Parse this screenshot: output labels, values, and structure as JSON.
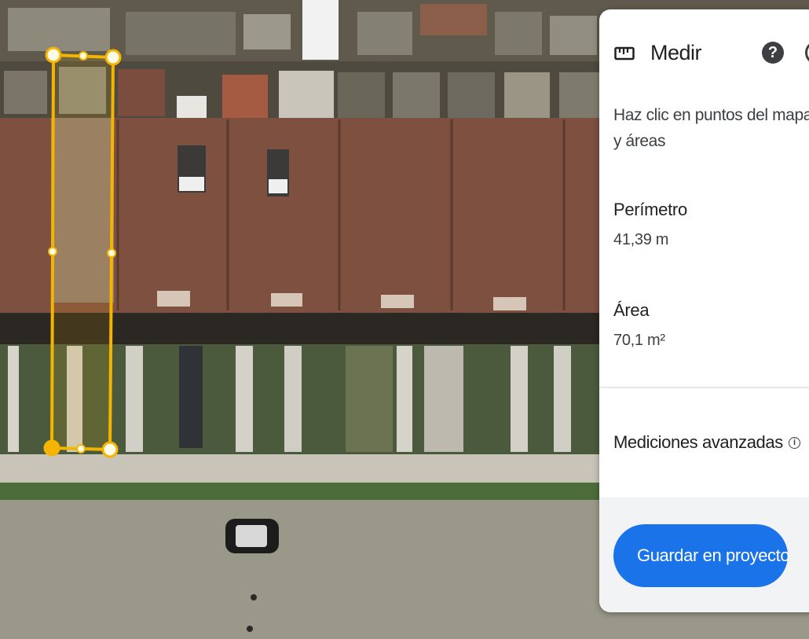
{
  "panel": {
    "title": "Medir",
    "icons": {
      "measure": "ruler-icon",
      "help": "help-icon",
      "close": "close-icon"
    },
    "instructions_line1": "Haz clic en puntos del mapa para",
    "instructions_line2": "y áreas",
    "perimeter_label": "Perímetro",
    "perimeter_value": "41,39 m",
    "area_label": "Área",
    "area_value": "70,1 m²",
    "advanced_label": "Mediciones avanzadas",
    "advanced_info_icon": "info-icon",
    "save_button_label": "Guardar en proyecto",
    "save_icon": "bookmark-icon"
  },
  "map": {
    "view": "satellite",
    "measurement_color": "#f4b400"
  },
  "colors": {
    "accent": "#1a73e8",
    "text_primary": "#202124",
    "text_secondary": "#3c4043"
  }
}
